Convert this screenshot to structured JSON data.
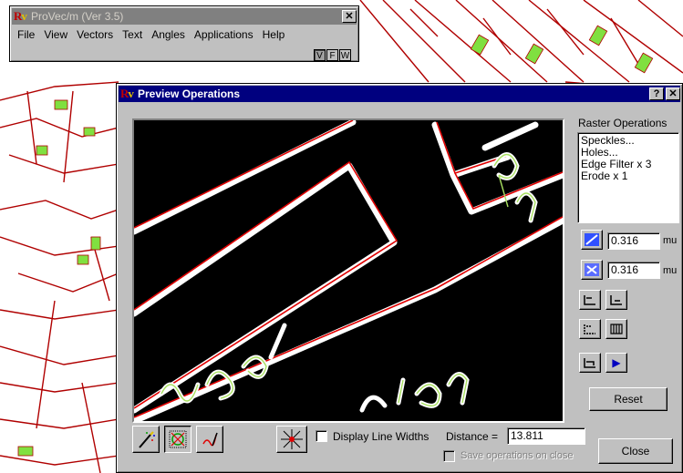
{
  "app_window": {
    "title": "ProVec/m (Ver 3.5)",
    "close_glyph": "✕",
    "menu": [
      "File",
      "View",
      "Vectors",
      "Text",
      "Angles",
      "Applications",
      "Help"
    ],
    "view_toggles": [
      "V",
      "F",
      "W"
    ]
  },
  "dialog": {
    "title": "Preview Operations",
    "help_glyph": "?",
    "close_glyph": "✕",
    "raster_ops_label": "Raster Operations",
    "raster_ops": [
      "Speckles...",
      "Holes...",
      "Edge Filter x 3",
      "Erode x 1"
    ],
    "value1": "0.316",
    "unit1": "mu",
    "value2": "0.316",
    "unit2": "mu",
    "reset_label": "Reset",
    "display_line_widths_label": "Display Line Widths",
    "distance_label": "Distance =",
    "distance_value": "13.811",
    "save_on_close_label": "Save operations on close",
    "close_label": "Close",
    "play_glyph": "▶"
  },
  "icons": [
    "magic-wand-icon",
    "vector-snap-icon",
    "pen-icon",
    "crosshair-icon",
    "raster-fill-icon",
    "raster-fill-alt-icon"
  ],
  "colors": {
    "vector": "#e00000",
    "raster_edge": "#a8e060",
    "title_active": "#00007f"
  },
  "map_labels": [
    "230/1",
    "2/12"
  ]
}
